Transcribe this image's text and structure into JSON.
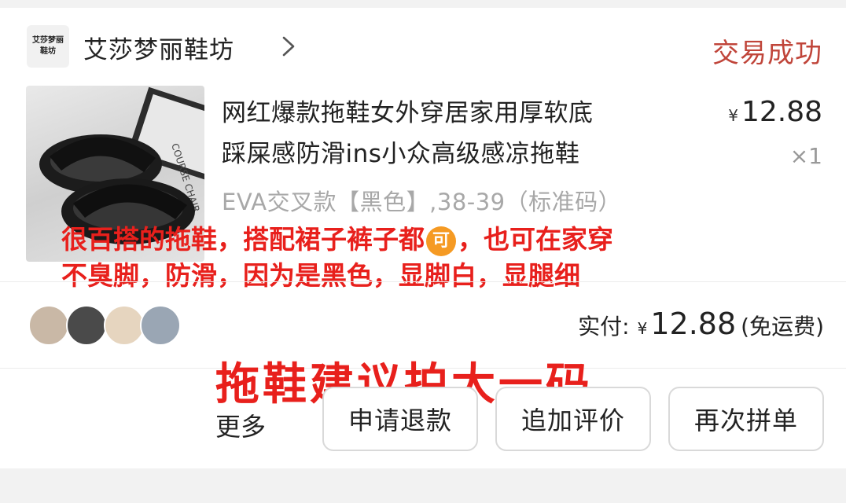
{
  "shop": {
    "logo_line1": "艾莎梦丽",
    "logo_line2": "鞋坊",
    "name": "艾莎梦丽鞋坊",
    "icon": "chevron-right-icon"
  },
  "order": {
    "status": "交易成功",
    "status_color": "#c0453a"
  },
  "product": {
    "title_line1": "网红爆款拖鞋女外穿居家用厚软底",
    "title_line2": "踩屎感防滑ins小众高级感凉拖鞋",
    "currency": "¥",
    "price": "12.88",
    "quantity": "×1",
    "spec": "EVA交叉款【黑色】,38-39（标准码）",
    "image_text": "COURSE CHAIR"
  },
  "review_overlay": {
    "line1_before": "很百搭的拖鞋，搭配裙子裤子都",
    "emoji_char": "可",
    "line1_after": "，也可在家穿",
    "line2": "不臭脚，防滑，因为是黑色，显脚白，显腿细",
    "color": "#e8201c"
  },
  "buyers": {
    "avatars": [
      {
        "color": "#c9b8a6",
        "icon": "avatar-icon"
      },
      {
        "color": "#4a4a4a",
        "icon": "avatar-icon"
      },
      {
        "color": "#e6d5bf",
        "icon": "avatar-icon"
      },
      {
        "color": "#9aa6b4",
        "icon": "avatar-icon"
      }
    ]
  },
  "payment": {
    "label": "实付:",
    "currency": "¥",
    "amount": "12.88",
    "shipping_note": "(免运费)"
  },
  "tip_overlay": {
    "text": "拖鞋建议拍大一码"
  },
  "actions": {
    "more_label": "更多",
    "refund_label": "申请退款",
    "add_review_label": "追加评价",
    "reorder_label": "再次拼单"
  }
}
